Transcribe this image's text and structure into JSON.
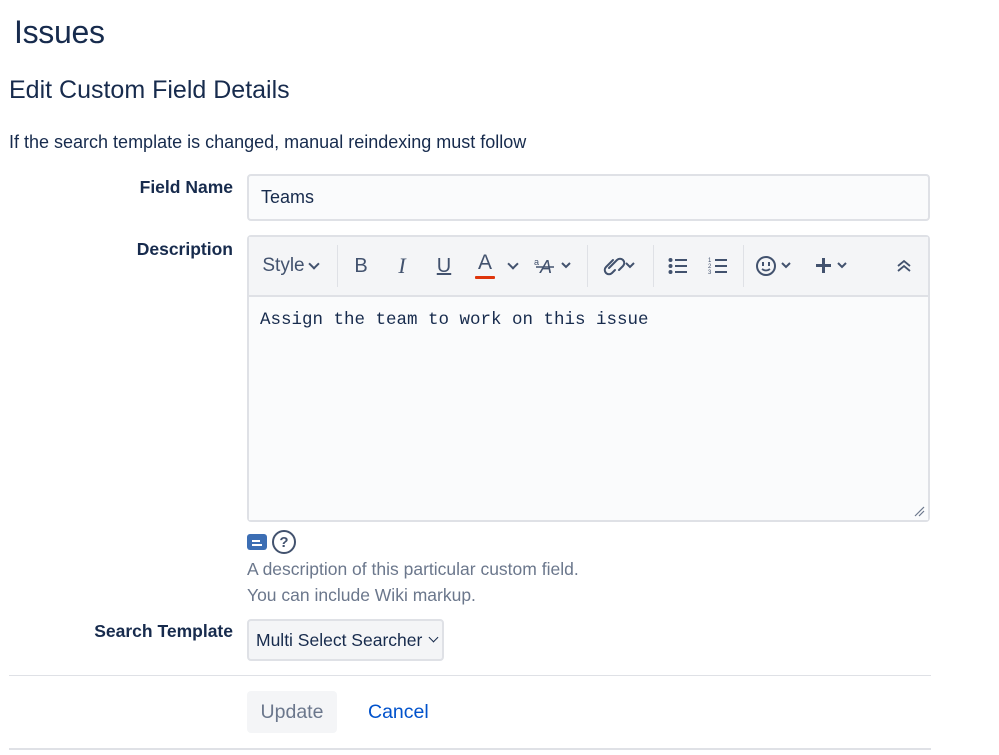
{
  "page": {
    "title": "Issues",
    "section_title": "Edit Custom Field Details",
    "intro": "If the search template is changed, manual reindexing must follow"
  },
  "form": {
    "field_name": {
      "label": "Field Name",
      "value": "Teams"
    },
    "description": {
      "label": "Description",
      "value": "Assign the team to work on this issue",
      "help_line1": "A description of this particular custom field.",
      "help_line2": "You can include Wiki markup."
    },
    "search_template": {
      "label": "Search Template",
      "selected": "Multi Select Searcher"
    }
  },
  "toolbar": {
    "style_label": "Style",
    "bold": "B",
    "italic": "I",
    "underline": "U",
    "text_color": "A",
    "text_color_underline": "#de350b",
    "icons": [
      "bold-icon",
      "italic-icon",
      "underline-icon",
      "text-color-icon",
      "text-effects-icon",
      "link-icon",
      "bullet-list-icon",
      "numbered-list-icon",
      "emoji-icon",
      "insert-plus-icon",
      "collapse-toolbar-icon"
    ]
  },
  "help": {
    "question_mark": "?"
  },
  "actions": {
    "update_label": "Update",
    "cancel_label": "Cancel"
  },
  "colors": {
    "text": "#172b4d",
    "link": "#0052cc",
    "muted": "#6b778c",
    "border": "#dfe1e6"
  }
}
